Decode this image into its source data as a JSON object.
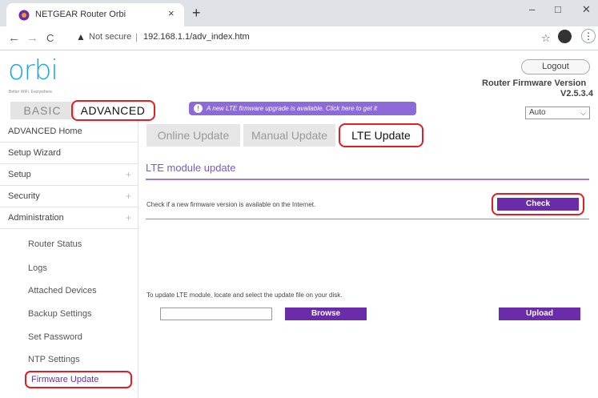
{
  "browser": {
    "tab_title": "NETGEAR Router Orbi",
    "tab_close": "×",
    "new_tab": "+",
    "minimize": "–",
    "maximize": "□",
    "close": "✕",
    "back": "←",
    "forward": "→",
    "reload": "C",
    "not_secure": "Not secure",
    "url": "192.168.1.1/adv_index.htm",
    "menu": "⋮"
  },
  "header": {
    "logo": "orbi",
    "tagline": "Better WiFi. Everywhere.",
    "logout": "Logout",
    "firmware_label": "Router Firmware Version",
    "firmware_version": "V2.5.3.4",
    "language": "Auto"
  },
  "top_tabs": {
    "basic": "BASIC",
    "advanced": "ADVANCED"
  },
  "banner": {
    "text": "A new LTE firmware upgrade is available. Click here to get it"
  },
  "sidebar": {
    "items": [
      {
        "label": "ADVANCED Home",
        "expandable": false
      },
      {
        "label": "Setup Wizard",
        "expandable": false
      },
      {
        "label": "Setup",
        "expandable": true
      },
      {
        "label": "Security",
        "expandable": true
      },
      {
        "label": "Administration",
        "expandable": true
      }
    ],
    "sub_items": [
      "Router Status",
      "Logs",
      "Attached Devices",
      "Backup Settings",
      "Set Password",
      "NTP Settings",
      "Firmware Update"
    ]
  },
  "content": {
    "tabs": [
      "Online Update",
      "Manual Update",
      "LTE Update"
    ],
    "section_title": "LTE module update",
    "check_text": "Check if a new firmware version is available on the Internet.",
    "check_button": "Check",
    "update_text": "To update LTE module, locate and select the update file on your disk.",
    "browse_button": "Browse",
    "upload_button": "Upload"
  },
  "colors": {
    "brand": "#18a6e0",
    "accent_purple": "#6a2ca8",
    "highlight_red": "#e01e24"
  }
}
